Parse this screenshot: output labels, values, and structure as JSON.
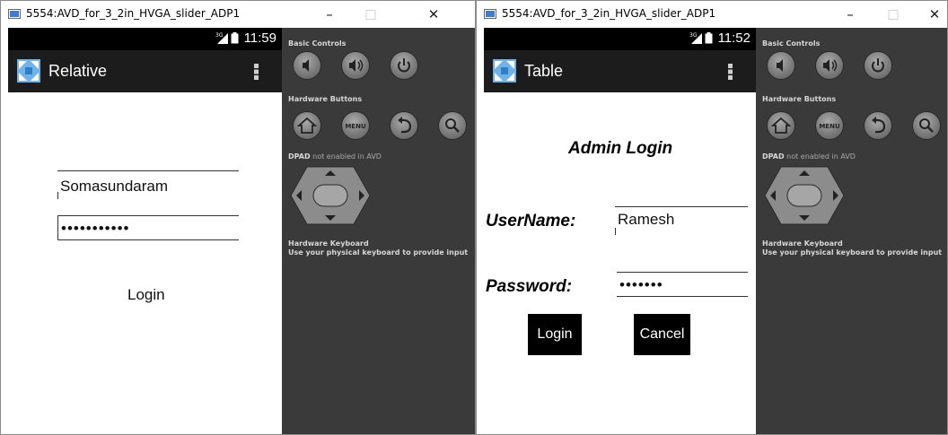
{
  "windows": [
    {
      "title": "5554:AVD_for_3_2in_HVGA_slider_ADP1",
      "controls": {
        "minimize": "–",
        "maximize": "□",
        "close": "✕"
      },
      "status": {
        "network": "3G",
        "time": "11:59"
      },
      "app_title": "Relative",
      "username_value": "Somasundaram",
      "password_value": "•••••••••••",
      "login_label": "Login"
    },
    {
      "title": "5554:AVD_for_3_2in_HVGA_slider_ADP1",
      "controls": {
        "minimize": "–",
        "maximize": "□",
        "close": "✕"
      },
      "status": {
        "network": "3G",
        "time": "11:52"
      },
      "app_title": "Table",
      "heading": "Admin Login",
      "username_label": "UserName:",
      "username_value": "Ramesh",
      "password_label": "Password:",
      "password_value": "•••••••",
      "login_label": "Login",
      "cancel_label": "Cancel"
    }
  ],
  "panel": {
    "basic_controls": "Basic Controls",
    "hardware_buttons": "Hardware Buttons",
    "dpad_bold": "DPAD",
    "dpad_rest": " not enabled in AVD",
    "keyboard_title": "Hardware Keyboard",
    "keyboard_note": "Use your physical keyboard to provide input",
    "menu_label": "MENU"
  },
  "icons": {
    "volume_down": "volume-down-icon",
    "volume_up": "volume-up-icon",
    "power": "power-icon",
    "home": "home-icon",
    "back": "back-icon",
    "search": "search-icon"
  },
  "colors": {
    "panel_bg": "#3a3a3a",
    "status_bar": "#000000",
    "action_bar": "#1c1c1c",
    "button_bg": "#000000"
  }
}
